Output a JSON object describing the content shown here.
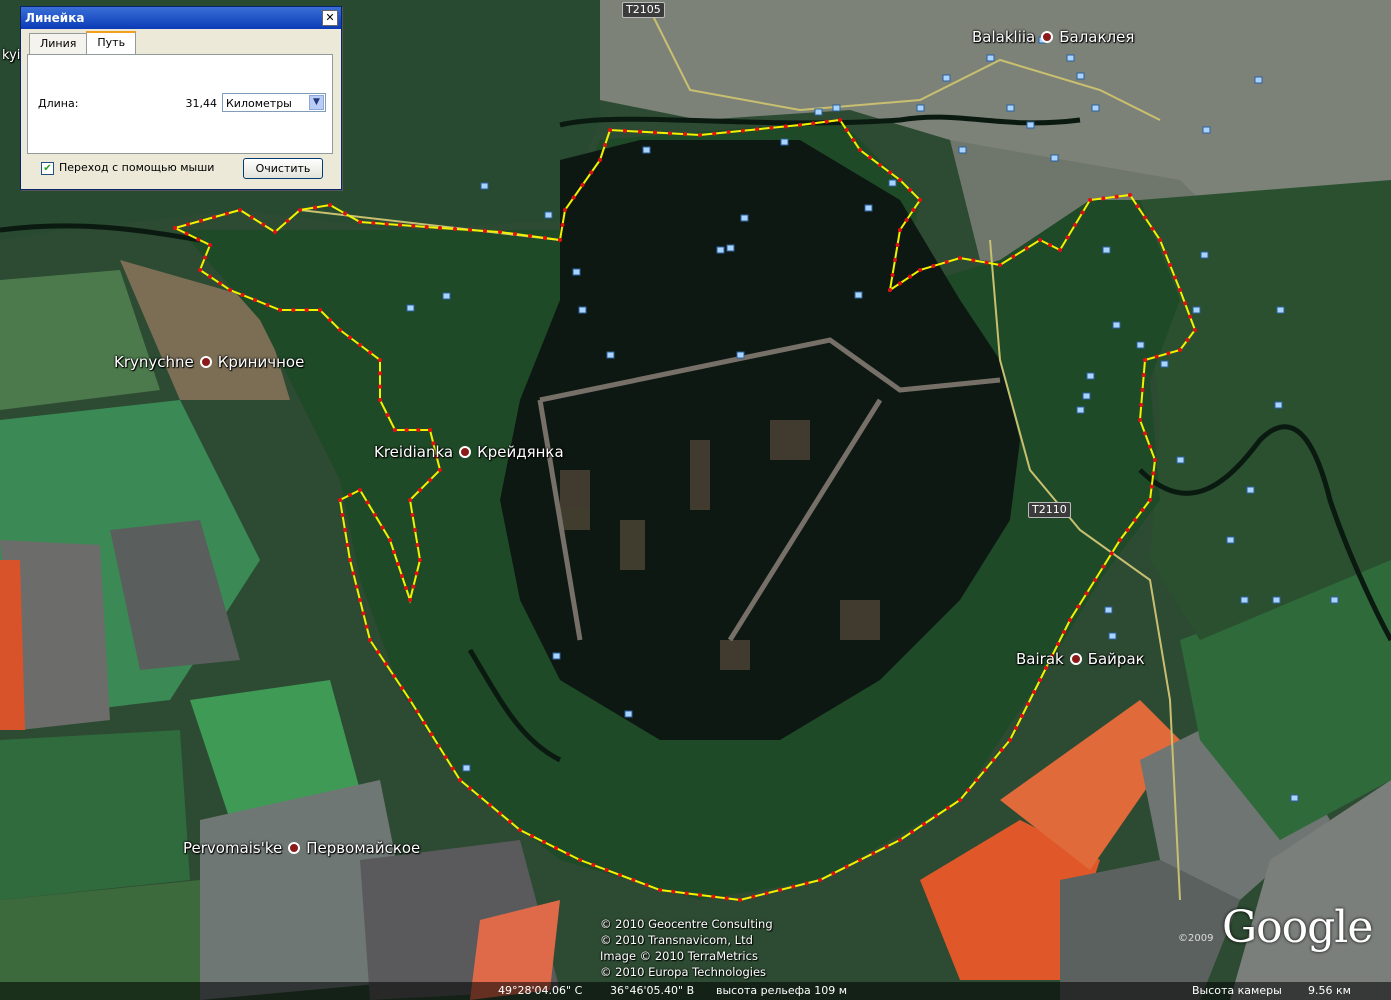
{
  "ruler_dialog": {
    "title": "Линейка",
    "close_glyph": "✕",
    "tabs": [
      {
        "label": "Линия",
        "active": false
      },
      {
        "label": "Путь",
        "active": true
      }
    ],
    "length_label": "Длина:",
    "length_value": "31,44",
    "unit_selected": "Километры",
    "mouse_nav_checked": true,
    "mouse_nav_label": "Переход с помощью мыши",
    "clear_button": "Очистить"
  },
  "places": [
    {
      "latin": "Balakliia",
      "cyrillic": "Балаклея"
    },
    {
      "latin": "Krynychne",
      "cyrillic": "Криничное"
    },
    {
      "latin": "Kreidianka",
      "cyrillic": "Крейдянка"
    },
    {
      "latin": "Bairak",
      "cyrillic": "Байрак"
    },
    {
      "latin": "Pervomais'ke",
      "cyrillic": "Первомайское"
    }
  ],
  "roads": [
    "T2105",
    "T2110"
  ],
  "copyright": [
    "© 2010 Geocentre Consulting",
    "© 2010 Transnavicom, Ltd",
    "Image © 2010 TerraMetrics",
    "© 2010 Europa Technologies"
  ],
  "google_logo": "Google",
  "google_year": "©2009",
  "status": {
    "lat": "49°28'04.06\" С",
    "lon": "36°46'05.40\" В",
    "elevation": "высота рельефа  109 м",
    "eye_alt_label": "Высота камеры",
    "eye_alt_value": "9.56 км"
  },
  "edge_fragment": "kyi",
  "colors": {
    "path_line": "#f2f200",
    "path_points": "#e01010",
    "water": "#0f1a14",
    "forest": "#1f4a26",
    "field_green": "#3f8f55",
    "field_orange": "#e05a2a",
    "urban": "#7c8277"
  }
}
